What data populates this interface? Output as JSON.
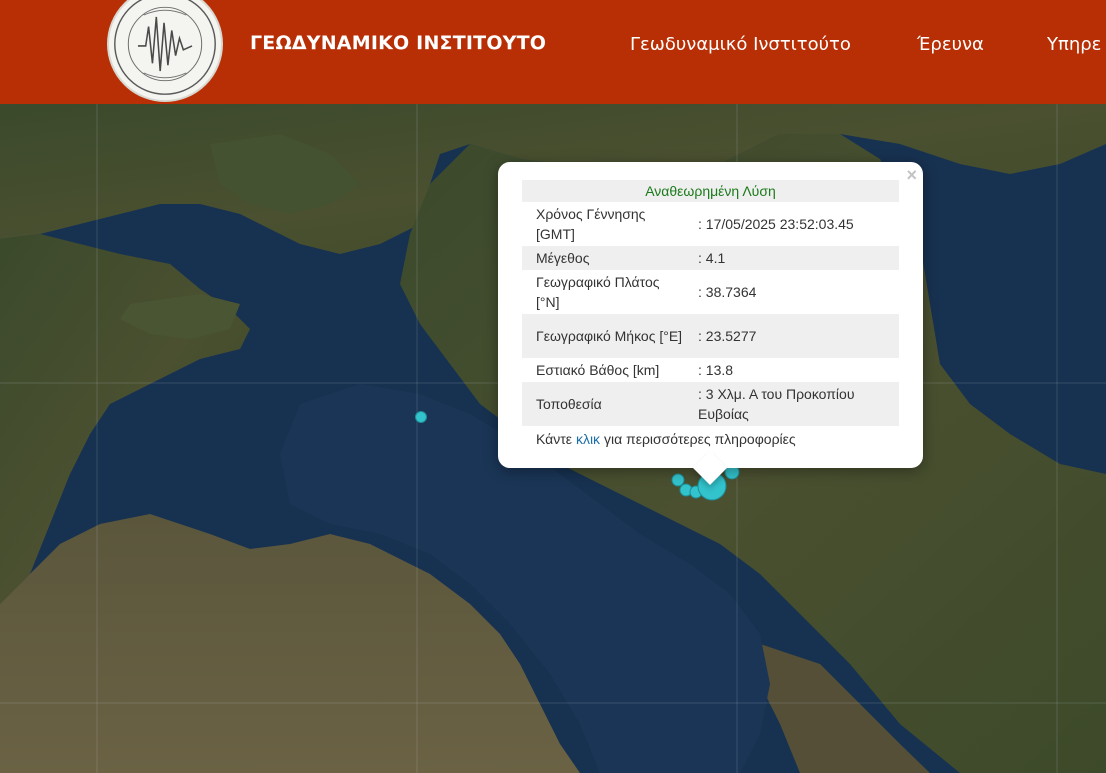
{
  "header": {
    "site_title": "ΓΕΩΔΥΝΑΜΙΚΟ ΙΝΣΤΙΤΟΥΤΟ",
    "nav": [
      {
        "label": "Γεωδυναμικό Ινστιτούτο"
      },
      {
        "label": "Έρευνα"
      },
      {
        "label": "Υπηρε"
      }
    ],
    "brand_color": "#b82f06"
  },
  "map": {
    "marker_color": "#33c3cc",
    "earthquakes": [
      {
        "lon": 23.5277,
        "lat": 38.7364,
        "magnitude": 4.1
      }
    ]
  },
  "popup": {
    "heading": "Αναθεωρημένη Λύση",
    "rows": [
      {
        "label": "Χρόνος Γέννησης [GMT]",
        "value": ": 17/05/2025 23:52:03.45"
      },
      {
        "label": "Μέγεθος",
        "value": ": 4.1"
      },
      {
        "label": "Γεωγραφικό Πλάτος [°N]",
        "value": ": 38.7364"
      },
      {
        "label": "Γεωγραφικό Μήκος [°E]",
        "value": ": 23.5277"
      },
      {
        "label": "Εστιακό Βάθος [km]",
        "value": ": 13.8"
      },
      {
        "label": "Τοποθεσία",
        "value": ": 3 Χλμ. Α του Προκοπίου Ευβοίας"
      }
    ],
    "footer_prefix": "Κάντε",
    "footer_link": "κλικ",
    "footer_suffix": "για περισσότερες πληροφορίες",
    "close_label": "×"
  }
}
